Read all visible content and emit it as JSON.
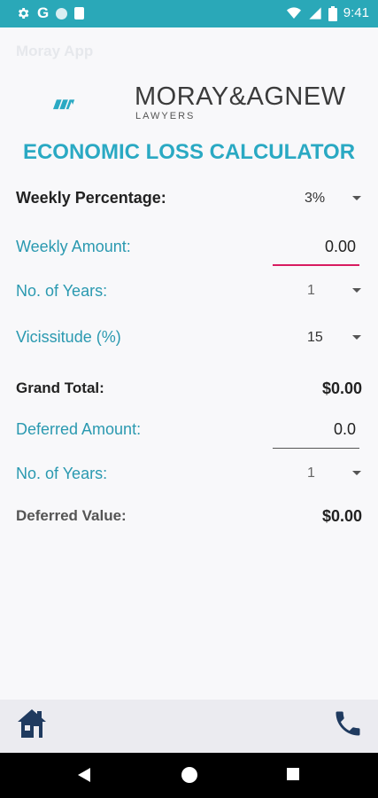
{
  "status_bar": {
    "time": "9:41",
    "google_letter": "G"
  },
  "app_bar": {
    "title": "Moray App"
  },
  "logo": {
    "name": "MORAY&AGNEW",
    "subtitle": "LAWYERS"
  },
  "page_title": "ECONOMIC LOSS CALCULATOR",
  "weekly_percentage": {
    "label": "Weekly Percentage:",
    "value": "3%"
  },
  "weekly_amount": {
    "label": "Weekly Amount:",
    "value": "0.00"
  },
  "no_of_years_1": {
    "label": "No. of Years:",
    "value": "1"
  },
  "vicissitude": {
    "label": "Vicissitude (%)",
    "value": "15"
  },
  "grand_total": {
    "label": "Grand Total:",
    "value": "$0.00"
  },
  "deferred_amount": {
    "label": "Deferred Amount:",
    "value": "0.0"
  },
  "no_of_years_2": {
    "label": "No. of Years:",
    "value": "1"
  },
  "deferred_value": {
    "label": "Deferred Value:",
    "value": "$0.00"
  },
  "colors": {
    "status_bar": "#2aa8b8",
    "accent": "#2aa9c3",
    "focus_underline": "#d81b60",
    "icon_navy": "#1f3a5f"
  },
  "icons": {
    "home": "home-icon",
    "phone": "phone-icon",
    "settings": "gear-icon",
    "wifi": "wifi-icon",
    "signal": "signal-icon",
    "battery": "battery-icon"
  }
}
